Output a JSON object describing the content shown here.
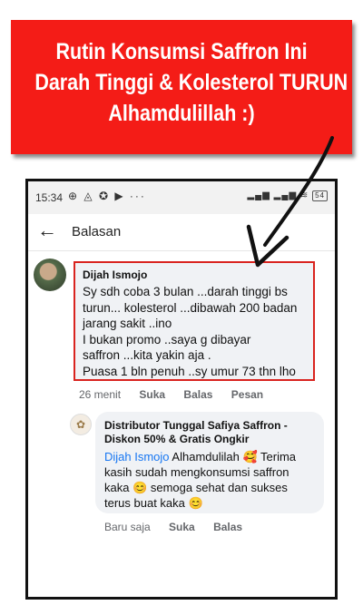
{
  "banner": {
    "lines": [
      "Rutin Konsumsi Saffron Ini",
      "Darah Tinggi & Kolesterol TURUN",
      "Alhamdulillah :)"
    ]
  },
  "status_bar": {
    "time": "15:34",
    "left_icons": "⊕ ◬ ✪ ▶ ···",
    "signal": "▂▄▆ ▂▄▆ ≋",
    "battery": "54"
  },
  "header": {
    "back_icon": "arrow-left-icon",
    "title": "Balasan"
  },
  "comment": {
    "author": "Dijah Ismojo",
    "lines": [
      "Sy sdh coba 3 bulan ...darah tinggi bs",
      "turun... kolesterol ...dibawah 200  badan",
      "jarang sakit ..ino",
      "I bukan promo ..saya  g dibayar",
      "saffron ...kita yakin aja .",
      "Puasa 1 bln penuh ..sy umur 73 thn lho"
    ],
    "time": "26 menit",
    "like_label": "Suka",
    "reply_label": "Balas",
    "message_label": "Pesan",
    "highlight_color": "#d9241f"
  },
  "reply": {
    "author_lines": [
      "Distributor Tunggal Safiya Saffron -",
      "Diskon 50% & Gratis Ongkir"
    ],
    "mention": "Dijah Ismojo",
    "first_line_rest": " Alhamdulilah 🥰 Terima",
    "lines": [
      "kasih sudah mengkonsumsi saffron",
      "kaka 😊 semoga sehat dan sukses",
      "terus buat kaka 😊"
    ],
    "time": "Baru saja",
    "like_label": "Suka",
    "reply_label": "Balas"
  },
  "colors": {
    "banner": "#f41c17",
    "link": "#1877f2",
    "meta": "#65676b"
  }
}
